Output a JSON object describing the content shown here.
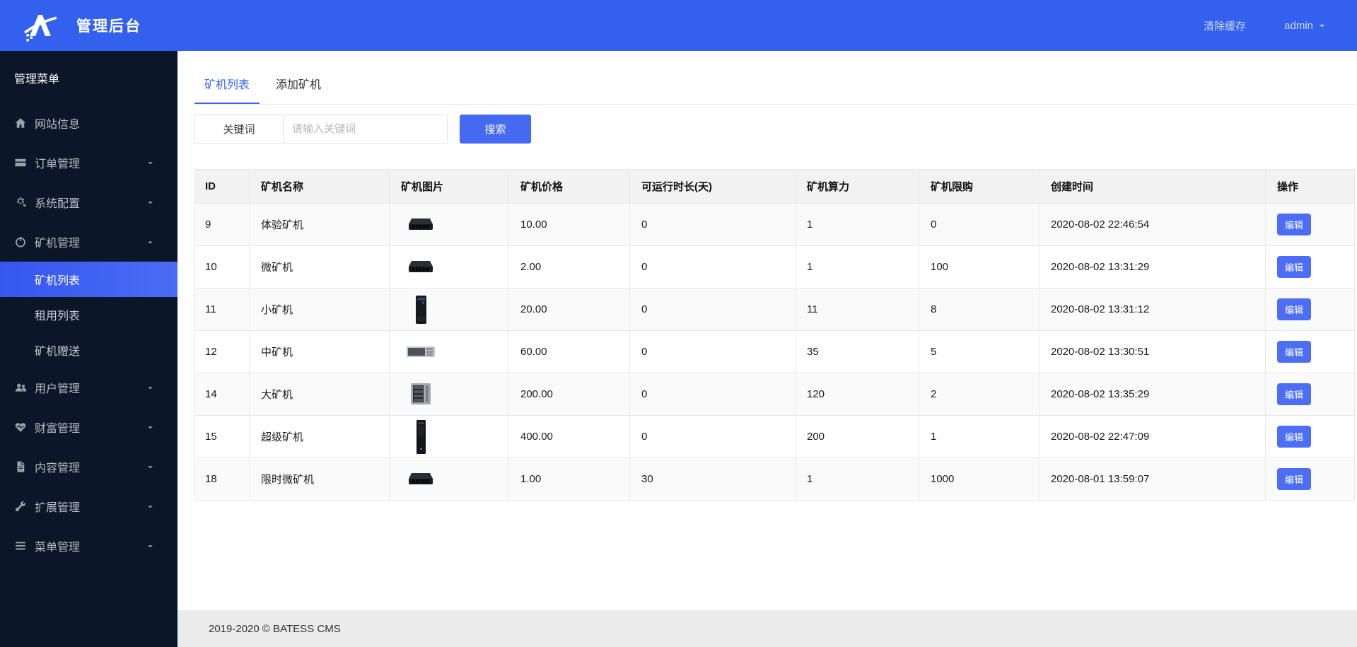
{
  "header": {
    "title": "管理后台",
    "clear_cache": "清除缓存",
    "username": "admin"
  },
  "sidebar": {
    "section_title": "管理菜单",
    "items": [
      {
        "key": "site-info",
        "label": "网站信息",
        "icon": "home-icon",
        "arrow": null
      },
      {
        "key": "order",
        "label": "订单管理",
        "icon": "order-icon",
        "arrow": "down"
      },
      {
        "key": "system-config",
        "label": "系统配置",
        "icon": "settings-icon",
        "arrow": "down"
      },
      {
        "key": "miner",
        "label": "矿机管理",
        "icon": "miner-icon",
        "arrow": "up",
        "expanded": true,
        "children": [
          {
            "key": "miner-list",
            "label": "矿机列表",
            "active": true
          },
          {
            "key": "rent-list",
            "label": "租用列表",
            "active": false
          },
          {
            "key": "miner-gift",
            "label": "矿机赠送",
            "active": false
          }
        ]
      },
      {
        "key": "user",
        "label": "用户管理",
        "icon": "users-icon",
        "arrow": "down"
      },
      {
        "key": "wealth",
        "label": "财富管理",
        "icon": "wealth-icon",
        "arrow": "down"
      },
      {
        "key": "content",
        "label": "内容管理",
        "icon": "content-icon",
        "arrow": "down"
      },
      {
        "key": "extension",
        "label": "扩展管理",
        "icon": "extension-icon",
        "arrow": "down"
      },
      {
        "key": "menu",
        "label": "菜单管理",
        "icon": "menu-icon",
        "arrow": "down"
      }
    ]
  },
  "tabs": [
    {
      "key": "miner-list",
      "label": "矿机列表",
      "active": true
    },
    {
      "key": "add-miner",
      "label": "添加矿机",
      "active": false
    }
  ],
  "search": {
    "label": "关键词",
    "placeholder": "请输入关键词",
    "value": "",
    "button": "搜索"
  },
  "table": {
    "columns": [
      "ID",
      "矿机名称",
      "矿机图片",
      "矿机价格",
      "可运行时长(天)",
      "矿机算力",
      "矿机限购",
      "创建时间",
      "操作"
    ],
    "edit_label": "编辑",
    "rows": [
      {
        "id": "9",
        "name": "体验矿机",
        "image": "flat-black",
        "price": "10.00",
        "duration": "0",
        "power": "1",
        "limit": "0",
        "created": "2020-08-02 22:46:54"
      },
      {
        "id": "10",
        "name": "微矿机",
        "image": "flat-black",
        "price": "2.00",
        "duration": "0",
        "power": "1",
        "limit": "100",
        "created": "2020-08-02 13:31:29"
      },
      {
        "id": "11",
        "name": "小矿机",
        "image": "tower-small",
        "price": "20.00",
        "duration": "0",
        "power": "11",
        "limit": "8",
        "created": "2020-08-02 13:31:12"
      },
      {
        "id": "12",
        "name": "中矿机",
        "image": "rack-silver",
        "price": "60.00",
        "duration": "0",
        "power": "35",
        "limit": "5",
        "created": "2020-08-02 13:30:51"
      },
      {
        "id": "14",
        "name": "大矿机",
        "image": "cube-gray",
        "price": "200.00",
        "duration": "0",
        "power": "120",
        "limit": "2",
        "created": "2020-08-02 13:35:29"
      },
      {
        "id": "15",
        "name": "超级矿机",
        "image": "tower-tall",
        "price": "400.00",
        "duration": "0",
        "power": "200",
        "limit": "1",
        "created": "2020-08-02 22:47:09"
      },
      {
        "id": "18",
        "name": "限时微矿机",
        "image": "flat-black",
        "price": "1.00",
        "duration": "30",
        "power": "1",
        "limit": "1000",
        "created": "2020-08-01 13:59:07"
      }
    ]
  },
  "footer": {
    "copyright": "2019-2020 © BATESS CMS"
  },
  "colors": {
    "header_bg": "#3361EE",
    "sidebar_bg": "#0B1628",
    "accent": "#3D63F0",
    "active_item_bg": "#3E63F0",
    "search_button_bg": "#4569F1",
    "edit_button_bg": "#4C6EF5",
    "table_header_bg": "#F2F2F2",
    "footer_bg": "#EBEBEB"
  }
}
